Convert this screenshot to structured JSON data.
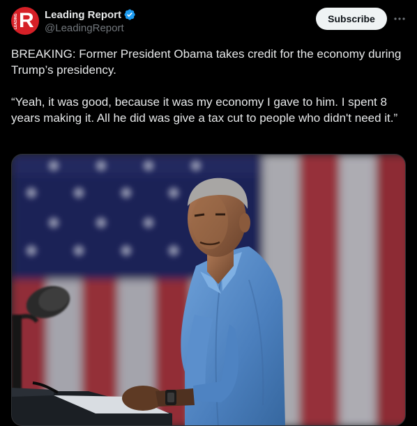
{
  "account": {
    "display_name": "Leading Report",
    "handle": "@LeadingReport",
    "avatar_letter": "R",
    "avatar_side_text": "LEADING",
    "verified": true,
    "avatar_color": "#d62027"
  },
  "actions": {
    "subscribe_label": "Subscribe",
    "more_icon": "more-horizontal-icon"
  },
  "tweet": {
    "paragraph_1": "BREAKING: Former President Obama takes credit for the economy during Trump’s presidency.",
    "paragraph_2": "“Yeah, it was good, because it was my economy I gave to him. I spent 8 years making it. All he did was give a tax cut to people who didn't need it.”"
  },
  "colors": {
    "background": "#000000",
    "text": "#e7e9ea",
    "muted": "#71767b",
    "verified_blue": "#1d9bf0",
    "button_bg": "#eff3f4"
  }
}
